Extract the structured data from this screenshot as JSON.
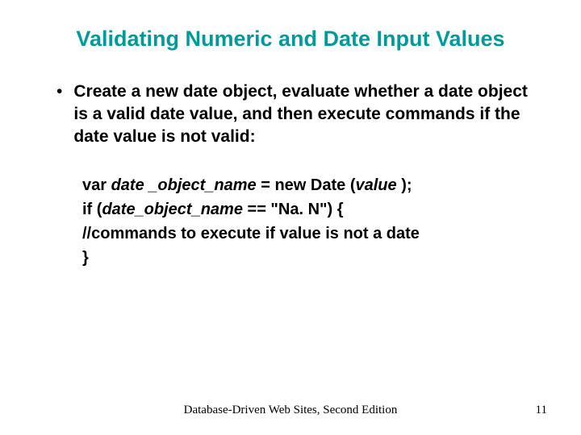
{
  "title": "Validating Numeric and Date Input Values",
  "bullet": "Create a new date object, evaluate whether a date object is a valid date value, and then execute commands if the date value is not valid:",
  "code": {
    "l1a": "var ",
    "l1b": "date _object_name ",
    "l1c": " = new Date (",
    "l1d": "value ",
    "l1e": ");",
    "l2a": "if (",
    "l2b": "date_object_name",
    "l2c": " == \"Na. N\") {",
    "l3": "//commands to execute if value is not a date",
    "l4": "}"
  },
  "footer_center": "Database-Driven Web Sites, Second Edition",
  "footer_right": "11"
}
